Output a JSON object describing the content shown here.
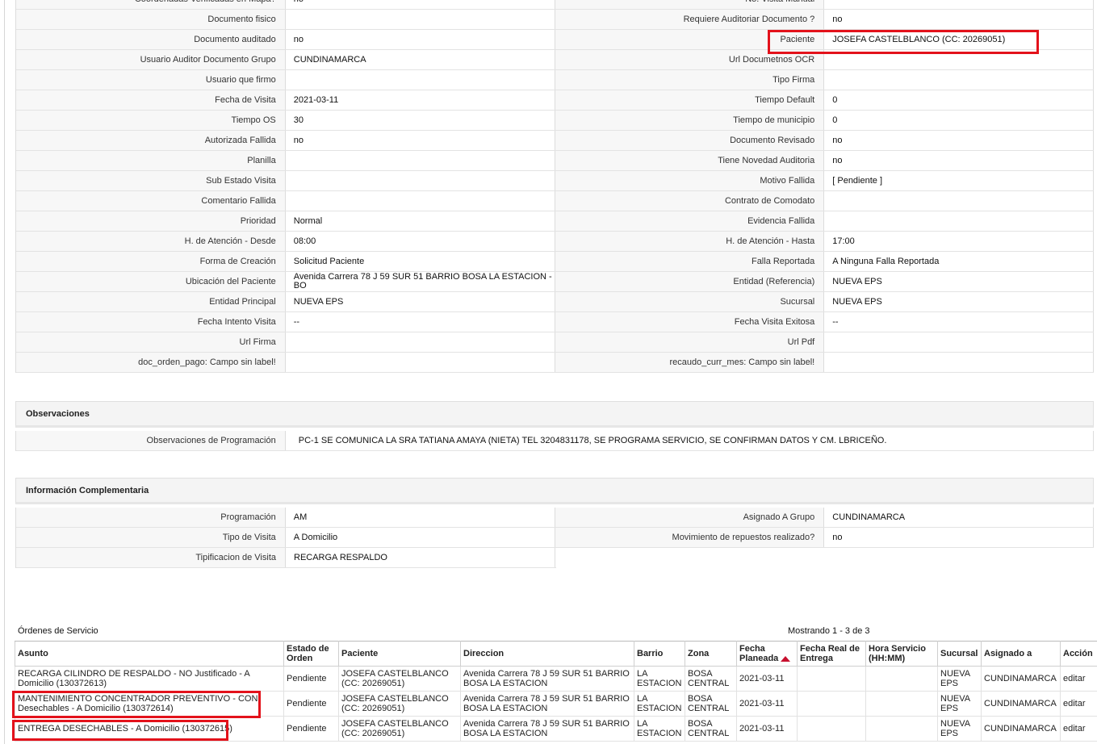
{
  "detail_rows": [
    {
      "l1": "Coordenadas Verificadas en Mapa?",
      "v1": "no",
      "l2": "No. Visita Manual",
      "v2": ""
    },
    {
      "l1": "Documento fisico",
      "v1": "",
      "l2": "Requiere Auditoriar Documento ?",
      "v2": "no"
    },
    {
      "l1": "Documento auditado",
      "v1": "no",
      "l2": "Paciente",
      "v2": "JOSEFA CASTELBLANCO (CC: 20269051)"
    },
    {
      "l1": "Usuario Auditor Documento Grupo",
      "v1": "CUNDINAMARCA",
      "l2": "Url Documetnos OCR",
      "v2": ""
    },
    {
      "l1": "Usuario que firmo",
      "v1": "",
      "l2": "Tipo Firma",
      "v2": ""
    },
    {
      "l1": "Fecha de Visita",
      "v1": "2021-03-11",
      "l2": "Tiempo Default",
      "v2": "0"
    },
    {
      "l1": "Tiempo OS",
      "v1": "30",
      "l2": "Tiempo de municipio",
      "v2": "0"
    },
    {
      "l1": "Autorizada Fallida",
      "v1": "no",
      "l2": "Documento Revisado",
      "v2": "no"
    },
    {
      "l1": "Planilla",
      "v1": "",
      "l2": "Tiene Novedad Auditoria",
      "v2": "no"
    },
    {
      "l1": "Sub Estado Visita",
      "v1": "",
      "l2": "Motivo Fallida",
      "v2": "[ Pendiente ]"
    },
    {
      "l1": "Comentario Fallida",
      "v1": "",
      "l2": "Contrato de Comodato",
      "v2": ""
    },
    {
      "l1": "Prioridad",
      "v1": "Normal",
      "l2": "Evidencia Fallida",
      "v2": ""
    },
    {
      "l1": "H. de Atención - Desde",
      "v1": "08:00",
      "l2": "H. de Atención - Hasta",
      "v2": "17:00"
    },
    {
      "l1": "Forma de Creación",
      "v1": "Solicitud Paciente",
      "l2": "Falla Reportada",
      "v2": "A Ninguna Falla Reportada"
    },
    {
      "l1": "Ubicación del Paciente",
      "v1": "Avenida Carrera 78 J 59 SUR 51 BARRIO BOSA LA ESTACION - BO",
      "l2": "Entidad (Referencia)",
      "v2": "NUEVA EPS"
    },
    {
      "l1": "Entidad Principal",
      "v1": "NUEVA EPS",
      "l2": "Sucursal",
      "v2": "NUEVA EPS"
    },
    {
      "l1": "Fecha Intento Visita",
      "v1": "--",
      "l2": "Fecha Visita Exitosa",
      "v2": "--"
    },
    {
      "l1": "Url Firma",
      "v1": "",
      "l2": "Url Pdf",
      "v2": ""
    },
    {
      "l1": "doc_orden_pago: Campo sin label!",
      "v1": "",
      "l2": "recaudo_curr_mes: Campo sin label!",
      "v2": ""
    }
  ],
  "observaciones": {
    "title": "Observaciones",
    "label": "Observaciones de Programación",
    "value": "PC-1 SE COMUNICA LA SRA TATIANA AMAYA (NIETA) TEL 3204831178, SE PROGRAMA SERVICIO, SE CONFIRMAN DATOS Y CM. LBRICEÑO."
  },
  "complementaria": {
    "title": "Información Complementaria",
    "rows": [
      {
        "l1": "Programación",
        "v1": "AM",
        "l2": "Asignado A Grupo",
        "v2": "CUNDINAMARCA"
      },
      {
        "l1": "Tipo de Visita",
        "v1": "A Domicilio",
        "l2": "Movimiento de repuestos realizado?",
        "v2": "no"
      }
    ],
    "last": {
      "l1": "Tipificacion de Visita",
      "v1": "RECARGA RESPALDO"
    }
  },
  "orders": {
    "title": "Órdenes de Servicio",
    "showing": "Mostrando 1 - 3 de 3",
    "columns": [
      "Asunto",
      "Estado de Orden",
      "Paciente",
      "Direccion",
      "Barrio",
      "Zona",
      "Fecha Planeada",
      "Fecha Real de Entrega",
      "Hora Servicio (HH:MM)",
      "Sucursal",
      "Asignado a",
      "Acción"
    ],
    "rows": [
      {
        "asunto": "RECARGA CILINDRO DE RESPALDO - NO Justificado - A Domicilio (130372613)",
        "estado": "Pendiente",
        "paciente": "JOSEFA CASTELBLANCO (CC: 20269051)",
        "direccion": "Avenida Carrera 78 J 59 SUR 51 BARRIO BOSA LA ESTACION",
        "barrio": "LA ESTACION",
        "zona": "BOSA CENTRAL",
        "fecha": "2021-03-11",
        "real": "",
        "hora": "",
        "sucursal": "NUEVA EPS",
        "asignado": "CUNDINAMARCA",
        "accion": "editar"
      },
      {
        "asunto": "MANTENIMIENTO CONCENTRADOR PREVENTIVO - CON Desechables - A Domicilio (130372614)",
        "estado": "Pendiente",
        "paciente": "JOSEFA CASTELBLANCO (CC: 20269051)",
        "direccion": "Avenida Carrera 78 J 59 SUR 51 BARRIO BOSA LA ESTACION",
        "barrio": "LA ESTACION",
        "zona": "BOSA CENTRAL",
        "fecha": "2021-03-11",
        "real": "",
        "hora": "",
        "sucursal": "NUEVA EPS",
        "asignado": "CUNDINAMARCA",
        "accion": "editar"
      },
      {
        "asunto": "ENTREGA DESECHABLES - A Domicilio (130372615)",
        "estado": "Pendiente",
        "paciente": "JOSEFA CASTELBLANCO (CC: 20269051)",
        "direccion": "Avenida Carrera 78 J 59 SUR 51 BARRIO BOSA LA ESTACION",
        "barrio": "LA ESTACION",
        "zona": "BOSA CENTRAL",
        "fecha": "2021-03-11",
        "real": "",
        "hora": "",
        "sucursal": "NUEVA EPS",
        "asignado": "CUNDINAMARCA",
        "accion": "editar"
      }
    ]
  },
  "colors": {
    "highlight": "#e3121b",
    "label_bg": "#f7f7f7",
    "sort_arrow": "#c8102e"
  }
}
